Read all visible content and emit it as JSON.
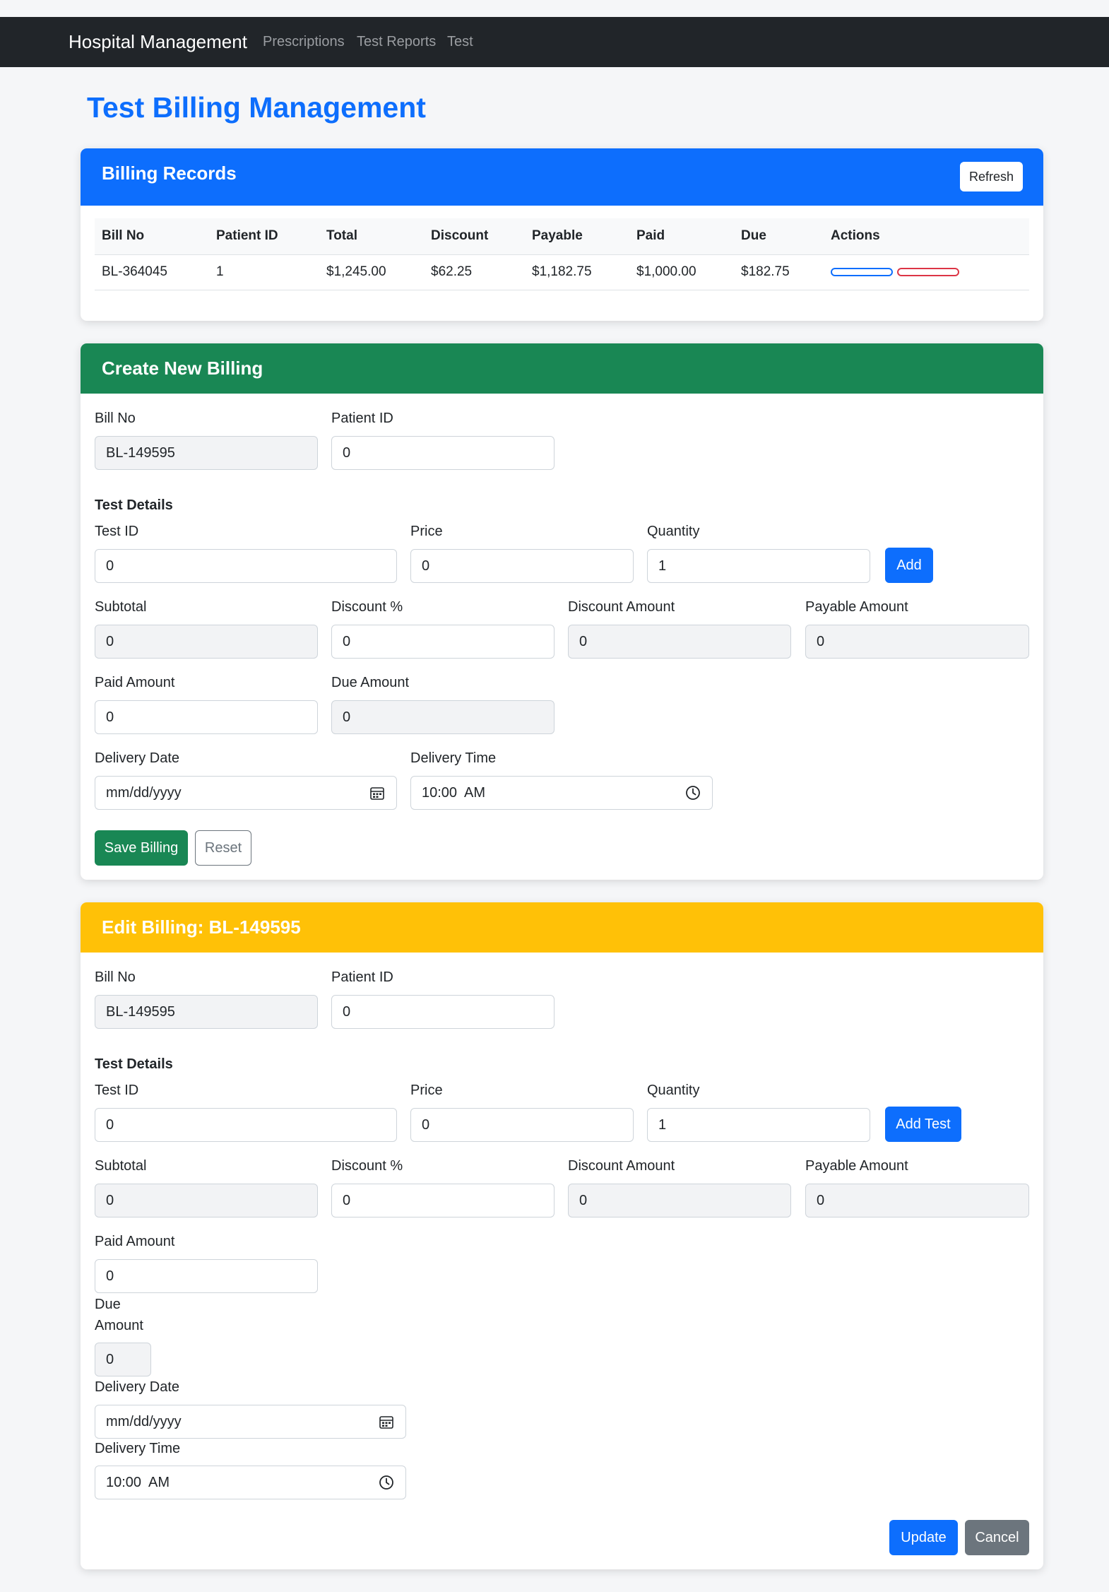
{
  "navbar": {
    "brand": "Hospital Management",
    "links": [
      "Prescriptions",
      "Test Reports",
      "Test"
    ]
  },
  "page_title": "Test Billing Management",
  "colors": {
    "navbar": "#212529",
    "primary": "#0d6efd",
    "success": "#198754",
    "warning": "#ffc107",
    "danger": "#dc3545",
    "secondary": "#6c757d"
  },
  "records": {
    "title": "Billing Records",
    "refresh_label": "Refresh",
    "columns": [
      "Bill No",
      "Patient ID",
      "Total",
      "Discount",
      "Payable",
      "Paid",
      "Due",
      "Actions"
    ],
    "rows": [
      [
        "BL-364045",
        "1",
        "$1,245.00",
        "$62.25",
        "$1,182.75",
        "$1,000.00",
        "$182.75"
      ]
    ]
  },
  "create": {
    "title": "Create New Billing",
    "bill_no_label": "Bill No",
    "bill_no": "BL-149595",
    "patient_id_label": "Patient ID",
    "patient_id": "0",
    "test_details_label": "Test Details",
    "test_id_label": "Test ID",
    "test_id": "0",
    "price_label": "Price",
    "price": "0",
    "quantity_label": "Quantity",
    "quantity": "1",
    "add_label": "Add",
    "subtotal_label": "Subtotal",
    "subtotal": "0",
    "discount_pct_label": "Discount %",
    "discount_pct": "0",
    "discount_amount_label": "Discount Amount",
    "discount_amount": "0",
    "payable_label": "Payable Amount",
    "payable": "0",
    "paid_label": "Paid Amount",
    "paid": "0",
    "due_label": "Due Amount",
    "due": "0",
    "delivery_date_label": "Delivery Date",
    "delivery_date": "mm/dd/yyyy",
    "delivery_time_label": "Delivery Time",
    "delivery_time": "10:00  AM",
    "save_label": "Save Billing",
    "reset_label": "Reset"
  },
  "edit": {
    "title": "Edit Billing: BL-149595",
    "bill_no_label": "Bill No",
    "bill_no": "BL-149595",
    "patient_id_label": "Patient ID",
    "patient_id": "0",
    "test_details_label": "Test Details",
    "test_id_label": "Test ID",
    "test_id": "0",
    "price_label": "Price",
    "price": "0",
    "quantity_label": "Quantity",
    "quantity": "1",
    "add_test_label": "Add Test",
    "subtotal_label": "Subtotal",
    "subtotal": "0",
    "discount_pct_label": "Discount %",
    "discount_pct": "0",
    "discount_amount_label": "Discount Amount",
    "discount_amount": "0",
    "payable_label": "Payable Amount",
    "payable": "0",
    "paid_label": "Paid Amount",
    "paid": "0",
    "due_label_line1": "Due",
    "due_label_line2": "Amount",
    "due": "0",
    "delivery_date_label": "Delivery Date",
    "delivery_date": "mm/dd/yyyy",
    "delivery_time_label": "Delivery Time",
    "delivery_time": "10:00  AM",
    "update_label": "Update",
    "cancel_label": "Cancel"
  }
}
